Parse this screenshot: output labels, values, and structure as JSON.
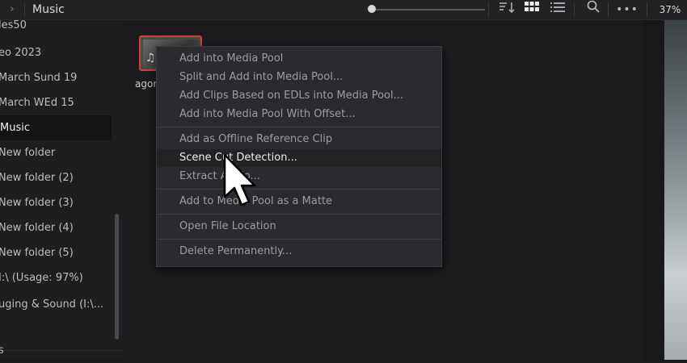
{
  "header": {
    "title": "Music",
    "zoom": "37%",
    "icons": [
      "chevron-right-icon",
      "sort-icon",
      "grid-view-icon",
      "list-view-icon",
      "search-icon",
      "more-icon"
    ]
  },
  "sidebar": {
    "items": [
      {
        "label": "les50"
      },
      {
        "label": "eo 2023"
      },
      {
        "label": "March Sund 19"
      },
      {
        "label": "March WEd 15"
      },
      {
        "label": "Music",
        "selected": true
      },
      {
        "label": "New folder"
      },
      {
        "label": "New folder (2)"
      },
      {
        "label": "New folder (3)"
      },
      {
        "label": "New folder (4)"
      },
      {
        "label": "New folder (5)"
      },
      {
        "label": "I:\\ (Usage: 97%)"
      },
      {
        "label": "uging & Sound (I:\\..."
      },
      {
        "label": "s"
      }
    ]
  },
  "clip": {
    "name": "agon"
  },
  "context_menu": {
    "items": [
      {
        "label": "Add into Media Pool"
      },
      {
        "label": "Split and Add into Media Pool..."
      },
      {
        "label": "Add Clips Based on EDLs into Media Pool..."
      },
      {
        "label": "Add into Media Pool With Offset..."
      },
      {
        "label": "Add as Offline Reference Clip"
      },
      {
        "label": "Scene Cut Detection...",
        "highlighted": true
      },
      {
        "label": "Extract Audio..."
      },
      {
        "label": "Add to Media Pool as a Matte"
      },
      {
        "label": "Open File Location"
      },
      {
        "label": "Delete Permanently..."
      }
    ]
  },
  "colors": {
    "selection_border": "#d0443a",
    "menu_bg": "#2b2b2f"
  }
}
